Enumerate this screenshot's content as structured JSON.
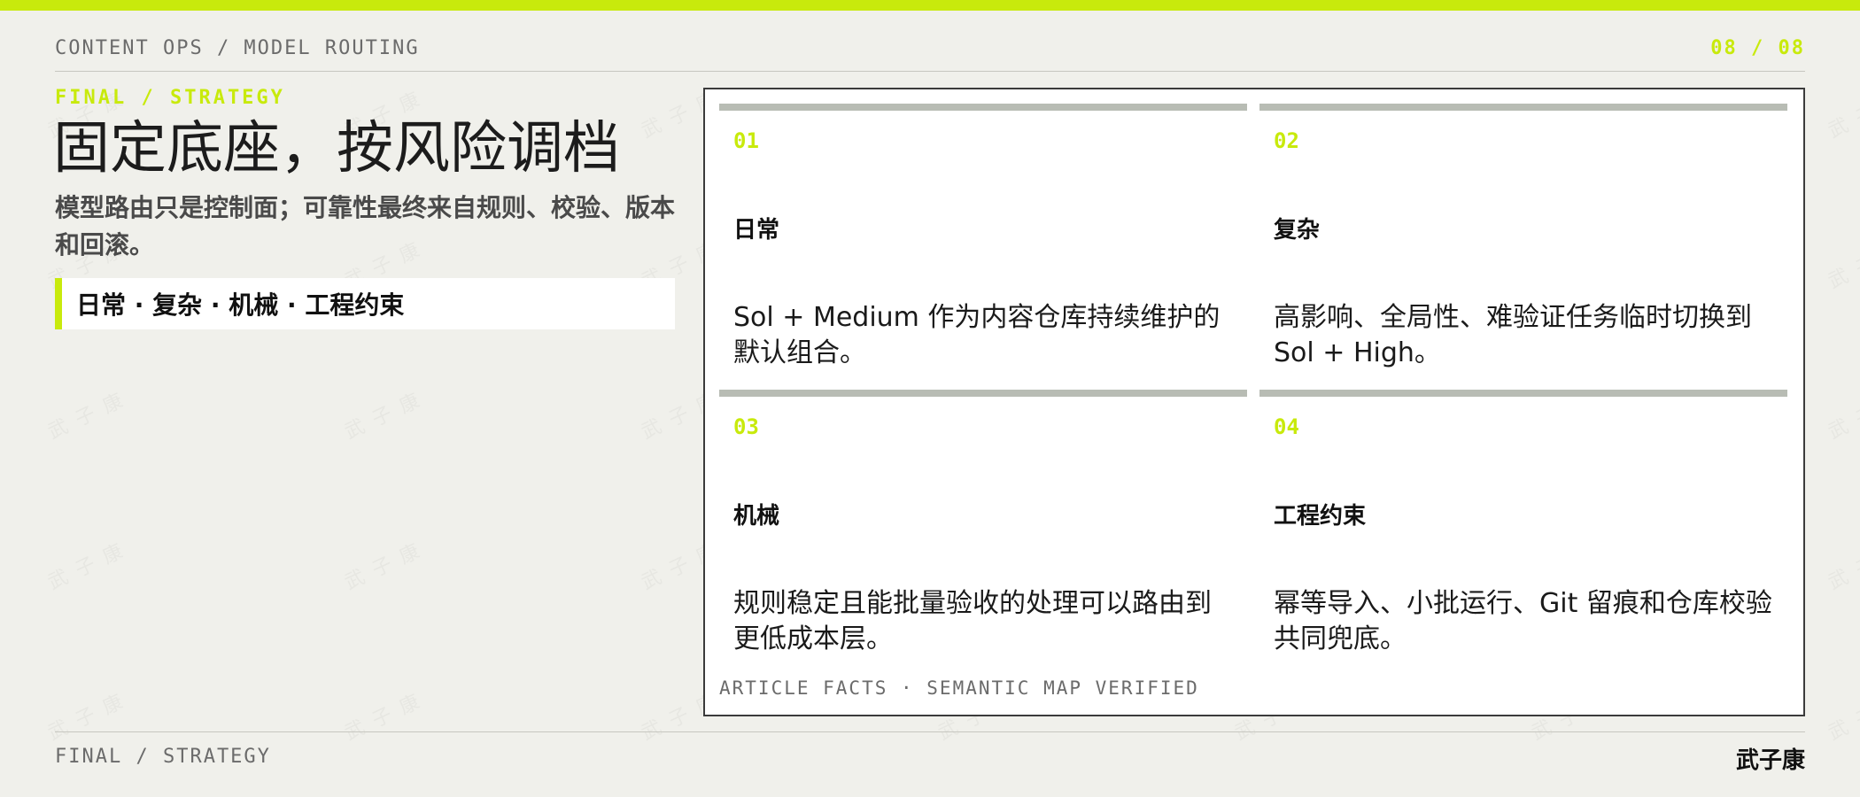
{
  "accent_color": "#c8ea0c",
  "header": {
    "breadcrumb": "CONTENT OPS / MODEL ROUTING",
    "page_counter": "08 / 08"
  },
  "left": {
    "kicker": "FINAL / STRATEGY",
    "title": "固定底座，按风险调档",
    "subtitle": "模型路由只是控制面；可靠性最终来自规则、校验、版本和回滚。",
    "tag": "日常 · 复杂 · 机械 · 工程约束"
  },
  "cards": [
    {
      "num": "01",
      "title": "日常",
      "body": "Sol + Medium 作为内容仓库持续维护的默认组合。"
    },
    {
      "num": "02",
      "title": "复杂",
      "body": "高影响、全局性、难验证任务临时切换到 Sol + High。"
    },
    {
      "num": "03",
      "title": "机械",
      "body": "规则稳定且能批量验收的处理可以路由到更低成本层。"
    },
    {
      "num": "04",
      "title": "工程约束",
      "body": "幂等导入、小批运行、Git 留痕和仓库校验共同兜底。"
    }
  ],
  "panel_footer": "ARTICLE FACTS · SEMANTIC MAP VERIFIED",
  "footer": {
    "section": "FINAL / STRATEGY",
    "author": "武子康"
  }
}
